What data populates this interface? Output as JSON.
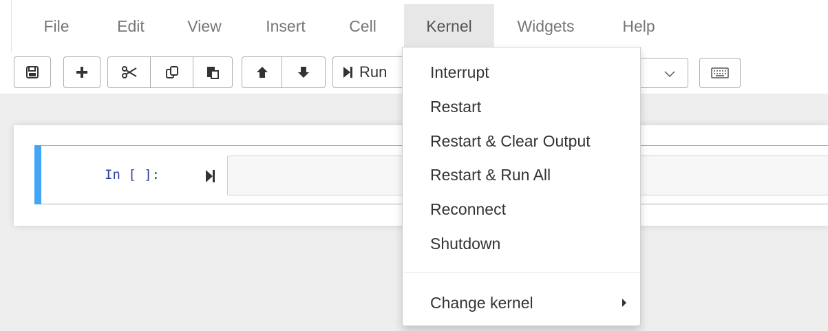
{
  "menubar": {
    "items": [
      "File",
      "Edit",
      "View",
      "Insert",
      "Cell",
      "Kernel",
      "Widgets",
      "Help"
    ],
    "active": "Kernel"
  },
  "toolbar": {
    "buttons": [
      {
        "icon": "save-icon"
      },
      {
        "icon": "plus-icon"
      },
      {
        "icon": "cut-icon"
      },
      {
        "icon": "copy-icon"
      },
      {
        "icon": "paste-icon"
      },
      {
        "icon": "arrow-up-icon"
      },
      {
        "icon": "arrow-down-icon"
      },
      {
        "icon": "run-icon"
      }
    ],
    "run_label": "Run",
    "cell_type_icon": "chevron-down-icon",
    "keyboard_icon": "keyboard-icon"
  },
  "cell": {
    "prompt": "In [ ]:",
    "input_value": "",
    "accent_color": "#42a5f5"
  },
  "kernel_menu": {
    "items": [
      "Interrupt",
      "Restart",
      "Restart & Clear Output",
      "Restart & Run All",
      "Reconnect",
      "Shutdown"
    ],
    "submenu_label": "Change kernel",
    "submenu_icon": "caret-right-icon"
  }
}
